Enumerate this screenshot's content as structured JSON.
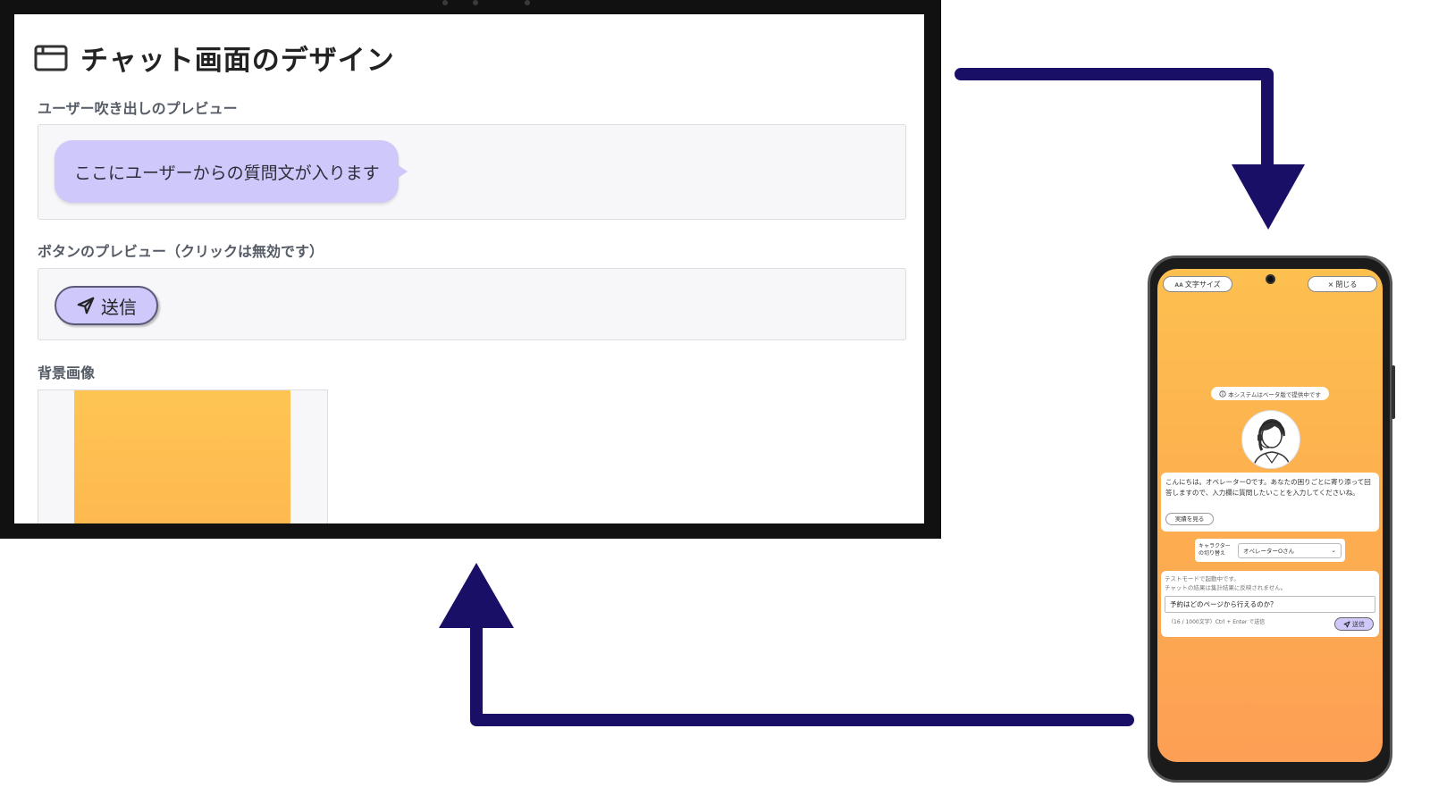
{
  "settings_screen": {
    "title": "チャット画面のデザイン",
    "bubble_section": {
      "label": "ユーザー吹き出しのプレビュー",
      "bubble_text": "ここにユーザーからの質問文が入ります"
    },
    "button_section": {
      "label": "ボタンのプレビュー（クリックは無効です）",
      "send_label": "送信"
    },
    "background_section": {
      "label": "背景画像"
    }
  },
  "phone": {
    "font_size_button": "文字サイズ",
    "font_size_prefix": "ᴀᴀ",
    "close_button": "閉じる",
    "close_prefix": "×",
    "beta_notice": "本システムはベータ版で提供中です",
    "greeting": "こんにちは。オペレーターOです。あなたの困りごとに寄り添って回答しますので、入力欄に質問したいことを入力してくださいね。",
    "record_button": "実績を見る",
    "character_switch_label": "キャラクターの切り替え",
    "character_selected": "オペレーターOさん",
    "test_mode_note_1": "テストモードで起動中です。",
    "test_mode_note_2": "チャットの結果は集計結果に反映されません。",
    "input_value": "予約はどのページから行えるのか？",
    "char_count": "（16 / 1000文字）Ctrl + Enter で送信",
    "send_label": "送信"
  },
  "colors": {
    "arrow": "#1a0f66",
    "bubble": "#cfc8fb",
    "bg_top": "#fec553",
    "bg_bottom": "#fd9f55"
  },
  "icons": [
    "window-icon",
    "send-icon",
    "info-icon",
    "chevron-down-icon",
    "operator-avatar"
  ]
}
